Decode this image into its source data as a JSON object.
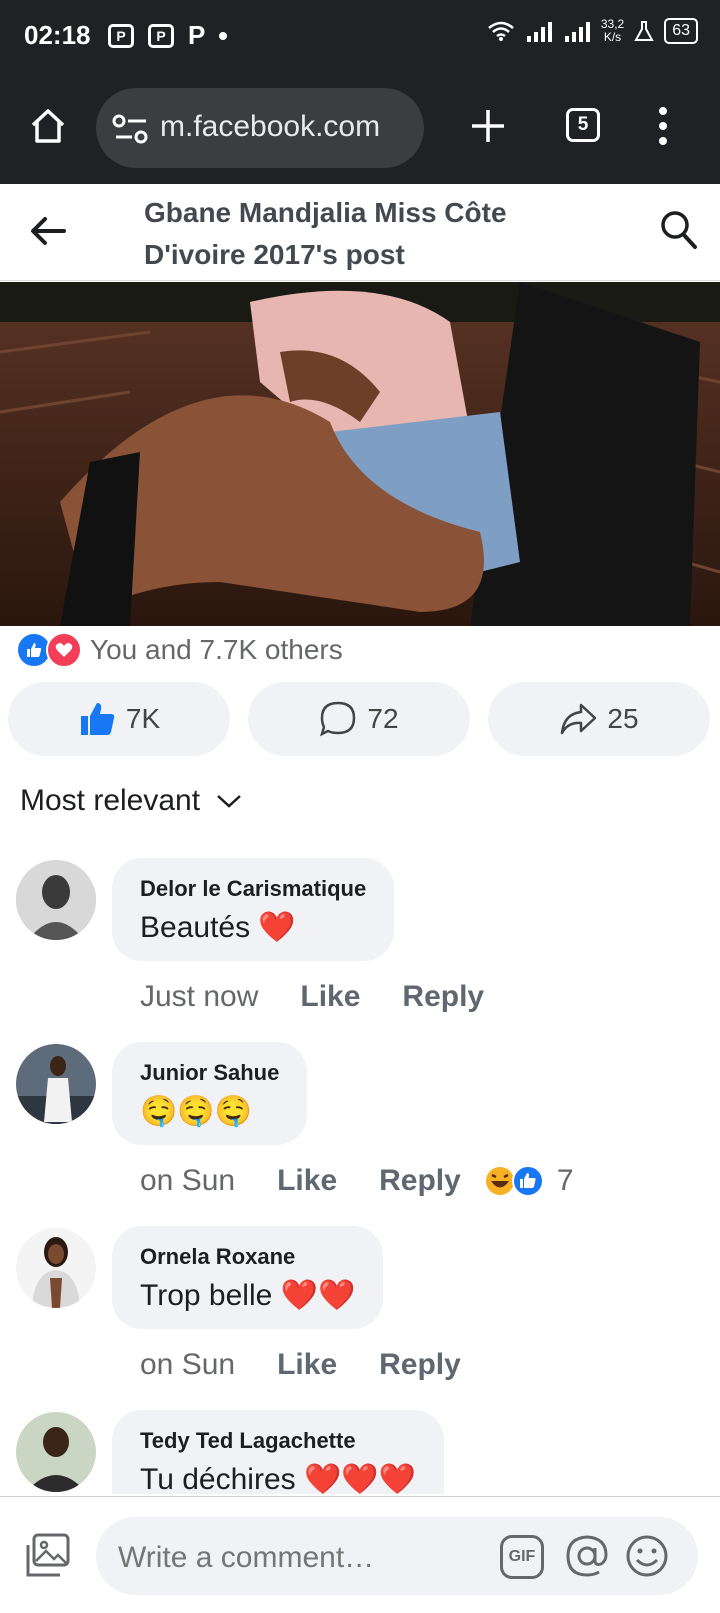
{
  "status_bar": {
    "time": "02:18",
    "app_icon_1": "P",
    "app_icon_2": "P",
    "app_icon_3": "P",
    "speed_value": "33,2",
    "speed_unit": "K/s",
    "battery": "63"
  },
  "browser": {
    "url": "m.facebook.com",
    "tab_count": "5"
  },
  "header": {
    "title": "Gbane Mandjalia Miss Côte D'ivoire 2017's post"
  },
  "reactions": {
    "summary": "You and 7.7K others"
  },
  "actions": {
    "like_count": "7K",
    "comment_count": "72",
    "share_count": "25"
  },
  "sort": {
    "label": "Most relevant"
  },
  "comments": [
    {
      "name": "Delor le Carismatique",
      "text": "Beautés ❤️",
      "time": "Just now",
      "like": "Like",
      "reply": "Reply"
    },
    {
      "name": "Junior Sahue",
      "text": "🤤🤤🤤",
      "time": "on Sun",
      "like": "Like",
      "reply": "Reply",
      "reaction_count": "7"
    },
    {
      "name": "Ornela Roxane",
      "text": "Trop belle ❤️❤️",
      "time": "on Sun",
      "like": "Like",
      "reply": "Reply"
    },
    {
      "name": "Tedy Ted Lagachette",
      "text": "Tu déchires ❤️❤️❤️"
    }
  ],
  "composer": {
    "placeholder": "Write a comment…",
    "gif_label": "GIF"
  },
  "colors": {
    "statusbar_bg": "#202124",
    "url_pill": "#3c3d40",
    "fb_blue": "#1877f2",
    "love_red": "#f33e58",
    "bubble_bg": "#f0f2f5",
    "meta_gray": "#65676b"
  }
}
